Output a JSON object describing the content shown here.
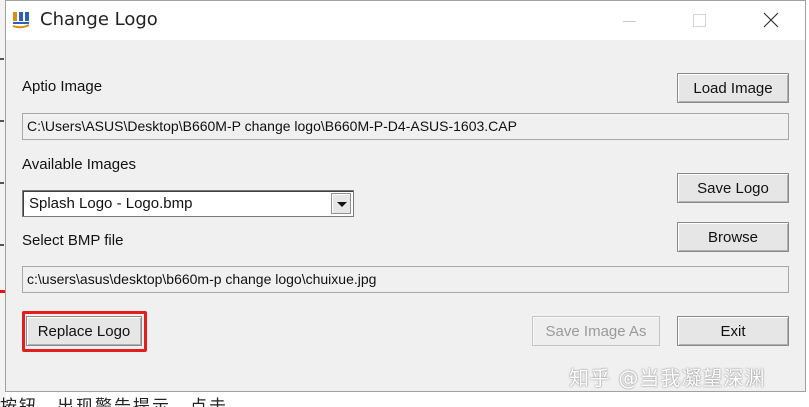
{
  "window": {
    "title": "Change Logo",
    "minimize_icon": "minimize-icon",
    "maximize_icon": "maximize-icon",
    "close_icon": "close-icon",
    "app_icon": "ami-logo-icon"
  },
  "aptio": {
    "label": "Aptio Image",
    "path": "C:\\Users\\ASUS\\Desktop\\B660M-P change logo\\B660M-P-D4-ASUS-1603.CAP",
    "load_button": "Load Image"
  },
  "images": {
    "label": "Available Images",
    "selected": "Splash Logo - Logo.bmp",
    "save_button": "Save Logo"
  },
  "bmp": {
    "label": "Select BMP file",
    "path": "c:\\users\\asus\\desktop\\b660m-p change logo\\chuixue.jpg",
    "browse_button": "Browse"
  },
  "actions": {
    "replace": "Replace Logo",
    "save_as": "Save Image As",
    "exit": "Exit"
  },
  "highlight_color": "#e41d1d",
  "watermark": "知乎 @当我凝望深渊",
  "background_text": "按钮，出现警告提示，点击"
}
